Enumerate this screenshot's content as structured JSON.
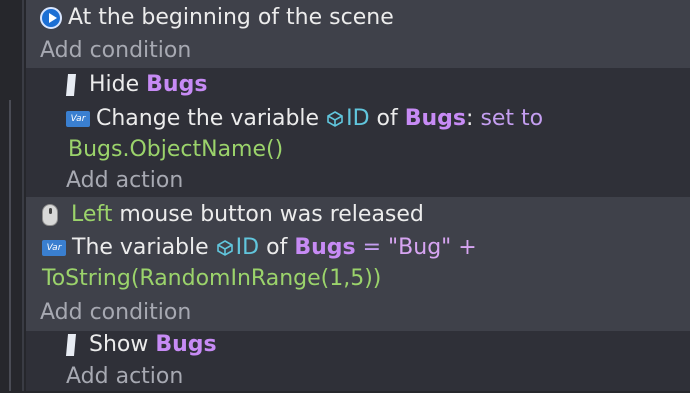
{
  "event1": {
    "condition_text": "At the beginning of the scene",
    "add_condition": "Add condition",
    "action1": {
      "verb": "Hide",
      "object": "Bugs"
    },
    "action2": {
      "prefix": "Change the variable",
      "variable": "ID",
      "of": "of",
      "object": "Bugs",
      "colon": ":",
      "op": "set to",
      "value": "Bugs.ObjectName()"
    },
    "add_action": "Add action"
  },
  "event2": {
    "condition1": {
      "button": "Left",
      "text": "mouse button was released"
    },
    "condition2": {
      "prefix": "The variable",
      "variable": "ID",
      "of": "of",
      "object": "Bugs",
      "op": "=",
      "value_line1": "\"Bug\" +",
      "value_line2": "ToString(RandomInRange(1,5))"
    },
    "add_condition": "Add condition",
    "action1": {
      "verb": "Show",
      "object": "Bugs"
    },
    "add_action": "Add action"
  },
  "icons": {
    "scene_start": "play-icon",
    "visibility": "visibility-icon",
    "variable": "var-icon",
    "mouse": "mouse-icon",
    "object_variable": "cube-icon"
  }
}
